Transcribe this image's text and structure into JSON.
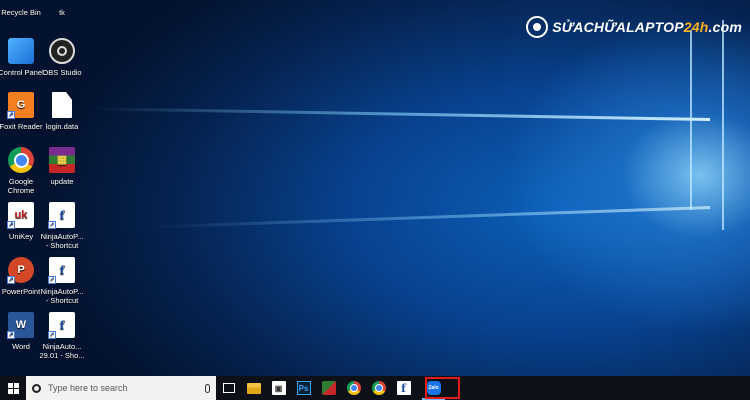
{
  "watermark": {
    "text_main": "SỬACHỮALAPTOP",
    "text_accent": "24h",
    "text_tail": ".com"
  },
  "desktop": {
    "icons": [
      {
        "label": "Recycle Bin",
        "icon": "recycle-bin-icon"
      },
      {
        "label": "tk",
        "icon": "file-icon"
      },
      {
        "label": "Control Panel",
        "icon": "control-panel-icon"
      },
      {
        "label": "OBS Studio",
        "icon": "obs-icon"
      },
      {
        "label": "Foxit Reader",
        "icon": "foxit-reader-icon"
      },
      {
        "label": "login.data",
        "icon": "file-icon"
      },
      {
        "label": "Google Chrome",
        "icon": "chrome-icon"
      },
      {
        "label": "update",
        "icon": "winrar-icon"
      },
      {
        "label": "UniKey",
        "icon": "unikey-icon"
      },
      {
        "label": "NinjaAutoP... - Shortcut",
        "icon": "facebook-icon"
      },
      {
        "label": "PowerPoint",
        "icon": "powerpoint-icon"
      },
      {
        "label": "NinjaAutoP... - Shortcut",
        "icon": "facebook-icon"
      },
      {
        "label": "Word",
        "icon": "word-icon"
      },
      {
        "label": "NinjaAuto... 29.01 - Sho...",
        "icon": "facebook-icon"
      }
    ]
  },
  "taskbar": {
    "search_placeholder": "Type here to search",
    "apps": [
      {
        "name": "Task View",
        "icon": "task-view-icon"
      },
      {
        "name": "File Explorer",
        "icon": "folder-icon"
      },
      {
        "name": "Store",
        "icon": "store-icon"
      },
      {
        "name": "Photoshop",
        "icon": "photoshop-icon",
        "glyph": "Ps"
      },
      {
        "name": "App",
        "icon": "app-icon"
      },
      {
        "name": "Chrome",
        "icon": "chrome-icon"
      },
      {
        "name": "Chrome",
        "icon": "chrome-icon"
      },
      {
        "name": "Facebook",
        "icon": "facebook-icon",
        "glyph": "f"
      },
      {
        "name": "Zalo",
        "icon": "zalo-icon",
        "glyph": "Zalo"
      }
    ]
  },
  "highlight_color": "#e21b1b"
}
